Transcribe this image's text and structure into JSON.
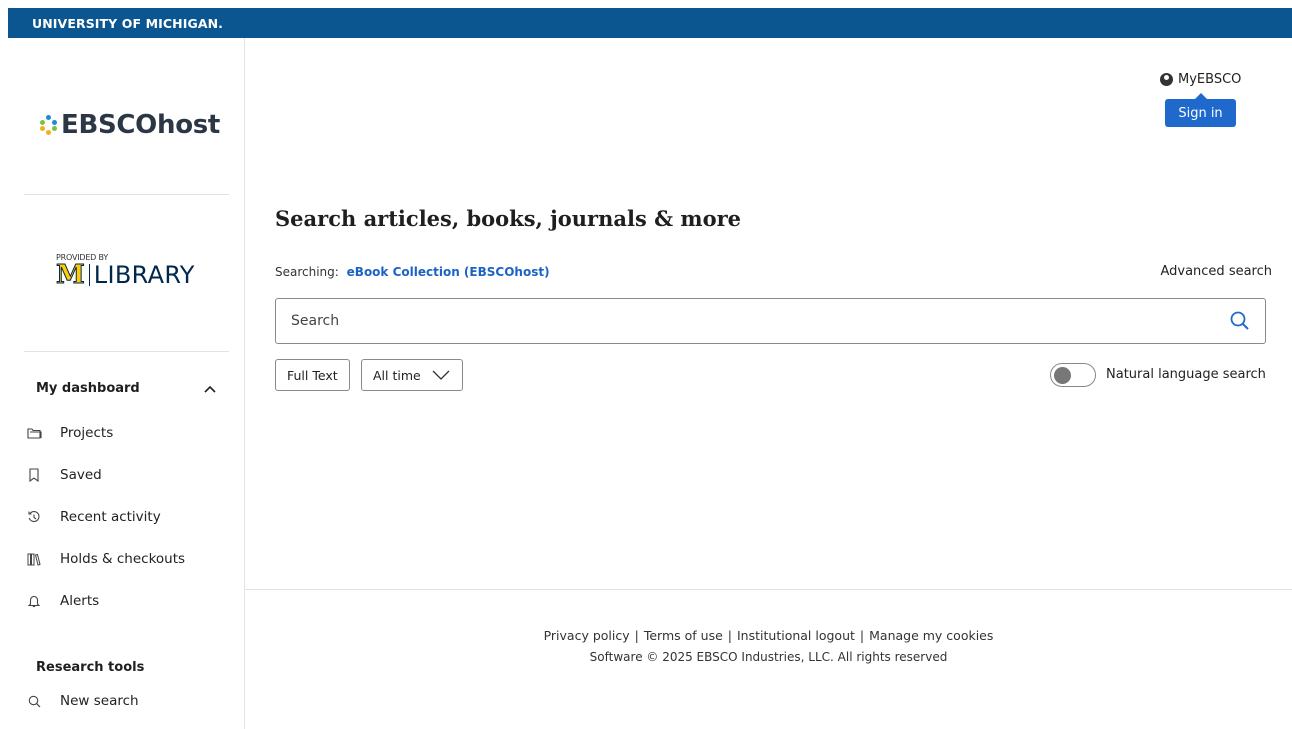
{
  "topbar": {
    "university": "UNIVERSITY OF MICHIGAN."
  },
  "sidebar": {
    "logo_text": "EBSCOhost",
    "provider": {
      "provided_by": "PROVIDED BY",
      "mark": "M",
      "library": "LIBRARY"
    },
    "dashboard": {
      "title": "My dashboard",
      "items": [
        {
          "label": "Projects",
          "icon": "folder-icon"
        },
        {
          "label": "Saved",
          "icon": "bookmark-icon"
        },
        {
          "label": "Recent activity",
          "icon": "history-icon"
        },
        {
          "label": "Holds & checkouts",
          "icon": "books-icon"
        },
        {
          "label": "Alerts",
          "icon": "bell-icon"
        }
      ]
    },
    "research_tools": {
      "title": "Research tools",
      "items": [
        {
          "label": "New search",
          "icon": "search-icon"
        }
      ]
    }
  },
  "header": {
    "myebsco": "MyEBSCO",
    "sign_in": "Sign in"
  },
  "main": {
    "headline": "Search articles, books, journals & more",
    "searching_label": "Searching:",
    "searching_value": "eBook Collection (EBSCOhost)",
    "advanced_search": "Advanced search",
    "search_placeholder": "Search",
    "filters": {
      "full_text": "Full Text",
      "time": "All time"
    },
    "natural_language": {
      "label": "Natural language search",
      "enabled": false
    }
  },
  "footer": {
    "links": [
      "Privacy policy",
      "Terms of use",
      "Institutional logout",
      "Manage my cookies"
    ],
    "copyright": "Software © 2025 EBSCO Industries, LLC. All rights reserved"
  },
  "colors": {
    "topbar": "#0b5590",
    "accent": "#1f69cc",
    "link": "#1b63c4",
    "maize": "#ffcb05",
    "blue": "#00274c"
  }
}
